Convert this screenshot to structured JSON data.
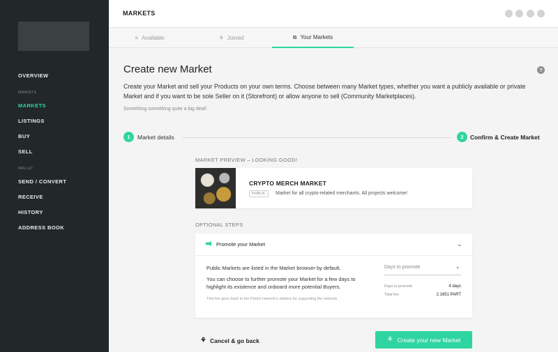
{
  "sidebar": {
    "items": [
      {
        "label": "OVERVIEW"
      },
      {
        "label": "MARKETS"
      },
      {
        "label": "LISTINGS"
      },
      {
        "label": "BUY"
      },
      {
        "label": "SELL"
      },
      {
        "label": "SEND / CONVERT"
      },
      {
        "label": "RECEIVE"
      },
      {
        "label": "HISTORY"
      },
      {
        "label": "ADDRESS BOOK"
      }
    ],
    "sections": {
      "markets": "MARKETS",
      "wallet": "WALLET"
    },
    "active_item": "MARKETS",
    "accent_color": "#2fd5a0"
  },
  "header": {
    "title": "MARKETS"
  },
  "tabs": [
    {
      "label": "Available",
      "icon": "list-icon"
    },
    {
      "label": "Joined",
      "icon": "network-icon"
    },
    {
      "label": "Your Markets",
      "icon": "window-icon",
      "active": true
    }
  ],
  "main": {
    "title": "Create new Market",
    "help_icon": "?",
    "intro": "Create your Market and sell your Products on your own terms. Choose between many Market types, whether you want a publicly available or private Market and if you want to be sole Seller on it (Storefront) or allow anyone to sell (Community Marketplaces).",
    "subtext": "Something something quite a big deal!"
  },
  "stepper": {
    "step1": {
      "number": "1",
      "label": "Market details"
    },
    "step2": {
      "number": "2",
      "label": "Confirm & Create Market"
    }
  },
  "preview": {
    "section_label": "MARKET PREVIEW – LOOKING GOOD!",
    "market_name": "CRYPTO MERCH MARKET",
    "badge": "PUBLIC",
    "description": "Market for all crypto-related merchants. All projects welcome!"
  },
  "optional": {
    "section_label": "OPTIONAL STEPS",
    "promote": {
      "title": "Promote your Market",
      "text1": "Public Markets are listed in the Market browser by default.",
      "text2": "You can choose to further promote your Market for a few days to highlight its existence and onboard more potential Buyers.",
      "note": "This fee goes back to the Particl network's stakers for supporting the network.",
      "select_placeholder": "Days to promote",
      "days_label": "Days to promote",
      "days_value": "4 days",
      "fee_label": "Total fee",
      "fee_value": "2.1651 PART"
    }
  },
  "actions": {
    "cancel": "Cancel & go back",
    "create": "Create your new Market"
  }
}
